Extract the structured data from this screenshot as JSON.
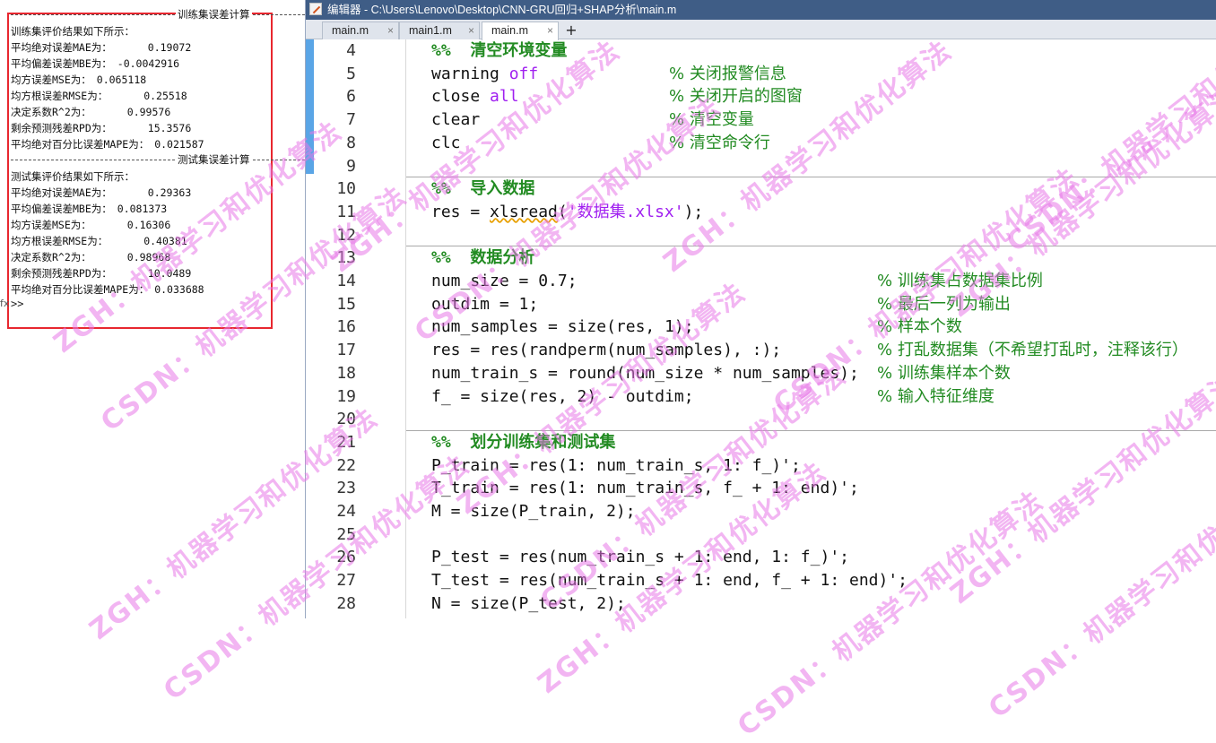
{
  "command_window": {
    "train_section_label": "训练集误差计算",
    "test_section_label": "测试集误差计算",
    "train_lines": [
      {
        "key": "训练集评价结果如下所示：",
        "value": ""
      },
      {
        "key": "平均绝对误差MAE为：",
        "value": "0.19072"
      },
      {
        "key": "平均偏差误差MBE为：",
        "value": "-0.0042916"
      },
      {
        "key": "均方误差MSE为：",
        "value": "0.065118"
      },
      {
        "key": "均方根误差RMSE为：",
        "value": "0.25518"
      },
      {
        "key": "决定系数R^2为：",
        "value": "0.99576"
      },
      {
        "key": "剩余预测残差RPD为：",
        "value": "15.3576"
      },
      {
        "key": "平均绝对百分比误差MAPE为：",
        "value": "0.021587"
      }
    ],
    "test_lines": [
      {
        "key": "测试集评价结果如下所示：",
        "value": ""
      },
      {
        "key": "平均绝对误差MAE为：",
        "value": "0.29363"
      },
      {
        "key": "平均偏差误差MBE为：",
        "value": "0.081373"
      },
      {
        "key": "均方误差MSE为：",
        "value": "0.16306"
      },
      {
        "key": "均方根误差RMSE为：",
        "value": "0.40381"
      },
      {
        "key": "决定系数R^2为：",
        "value": "0.98968"
      },
      {
        "key": "剩余预测残差RPD为：",
        "value": "10.0489"
      },
      {
        "key": "平均绝对百分比误差MAPE为：",
        "value": "0.033688"
      }
    ],
    "prompt": ">>",
    "fx": "fx"
  },
  "editor": {
    "title": "编辑器 - C:\\Users\\Lenovo\\Desktop\\CNN-GRU回归+SHAP分析\\main.m",
    "tabs": [
      {
        "label": "main.m",
        "close": "×"
      },
      {
        "label": "main1.m",
        "close": "×"
      },
      {
        "label": "main.m",
        "close": "×"
      }
    ],
    "add_tab": "+",
    "lines": [
      {
        "n": "4",
        "code": "%%  清空环境变量",
        "comment": ""
      },
      {
        "n": "5",
        "code": "warning off",
        "comment": "% 关闭报警信息"
      },
      {
        "n": "6",
        "code": "close all",
        "comment": "% 关闭开启的图窗"
      },
      {
        "n": "7",
        "code": "clear",
        "comment": "% 清空变量"
      },
      {
        "n": "8",
        "code": "clc",
        "comment": "% 清空命令行"
      },
      {
        "n": "9",
        "code": "",
        "comment": ""
      },
      {
        "n": "10",
        "code": "%%  导入数据",
        "comment": ""
      },
      {
        "n": "11",
        "code": "res = xlsread('数据集.xlsx');",
        "comment": ""
      },
      {
        "n": "12",
        "code": "",
        "comment": ""
      },
      {
        "n": "13",
        "code": "%%  数据分析",
        "comment": ""
      },
      {
        "n": "14",
        "code": "num_size = 0.7;",
        "comment": "% 训练集占数据集比例"
      },
      {
        "n": "15",
        "code": "outdim = 1;",
        "comment": "% 最后一列为输出"
      },
      {
        "n": "16",
        "code": "num_samples = size(res, 1);",
        "comment": "% 样本个数"
      },
      {
        "n": "17",
        "code": "res = res(randperm(num_samples), :);",
        "comment": "% 打乱数据集（不希望打乱时，注释该行）"
      },
      {
        "n": "18",
        "code": "num_train_s = round(num_size * num_samples);",
        "comment": "% 训练集样本个数"
      },
      {
        "n": "19",
        "code": "f_ = size(res, 2) - outdim;",
        "comment": "% 输入特征维度"
      },
      {
        "n": "20",
        "code": "",
        "comment": ""
      },
      {
        "n": "21",
        "code": "%%  划分训练集和测试集",
        "comment": ""
      },
      {
        "n": "22",
        "code": "P_train = res(1: num_train_s, 1: f_)';",
        "comment": ""
      },
      {
        "n": "23",
        "code": "T_train = res(1: num_train_s, f_ + 1: end)';",
        "comment": ""
      },
      {
        "n": "24",
        "code": "M = size(P_train, 2);",
        "comment": ""
      },
      {
        "n": "25",
        "code": "",
        "comment": ""
      },
      {
        "n": "26",
        "code": "P_test = res(num_train_s + 1: end, 1: f_)';",
        "comment": ""
      },
      {
        "n": "27",
        "code": "T_test = res(num_train_s + 1: end, f_ + 1: end)';",
        "comment": ""
      },
      {
        "n": "28",
        "code": "N = size(P_test, 2);",
        "comment": ""
      }
    ]
  },
  "watermark": {
    "line1": "ZGH：机器学习和优化算法",
    "line2": "CSDN：机器学习和优化算法"
  },
  "colors": {
    "title_bar": "#3f5d86",
    "comment": "#228b22",
    "keyword": "#a020f0",
    "highlight_box": "#e8272f",
    "gutter_marker": "#5aa5e6",
    "watermark": "#e878e8"
  }
}
